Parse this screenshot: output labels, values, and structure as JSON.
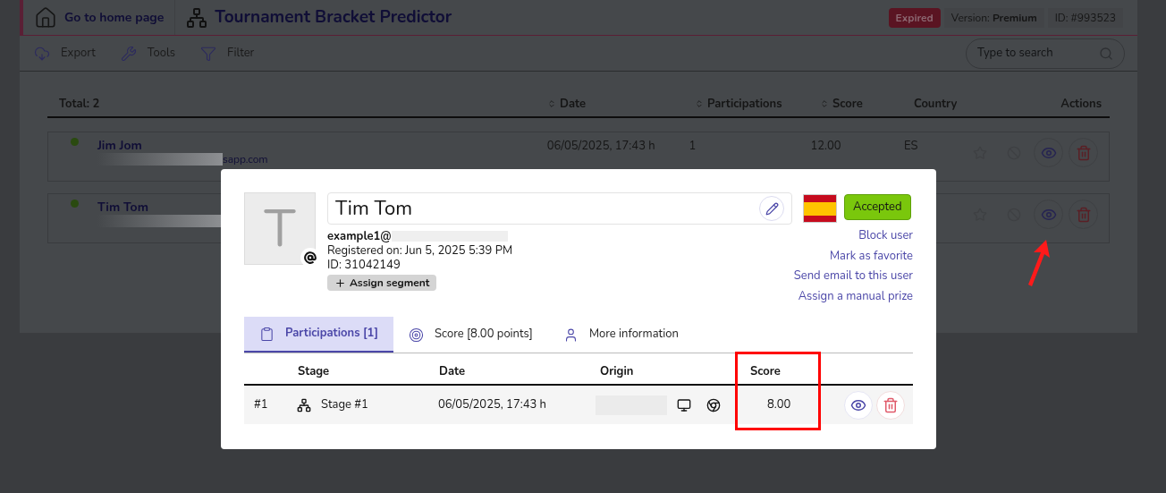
{
  "header": {
    "home_link": "Go to home page",
    "title": "Tournament Bracket Predictor",
    "status_badge": "Expired",
    "version_label": "Version:",
    "version_value": "Premium",
    "account_id": "ID: #993523"
  },
  "toolbar": {
    "actions": [
      "Export",
      "Tools",
      "Filter"
    ],
    "search": {
      "placeholder": "Type to search"
    }
  },
  "table": {
    "total": "Total: 2",
    "columns": [
      {
        "label": "Date",
        "sortable": true
      },
      {
        "label": "Participations",
        "sortable": true
      },
      {
        "label": "Score",
        "sortable": true
      },
      {
        "label": "Country",
        "sortable": false
      },
      {
        "label": "Actions",
        "sortable": false
      }
    ],
    "rows": [
      {
        "name": "Jim Jom",
        "email_tail": "sapp.com",
        "date": "06/05/2025, 17:43 h",
        "participations": "1",
        "score": "12.00",
        "country": "ES"
      },
      {
        "name": "Tim Tom",
        "date": "",
        "participations": "",
        "score": "",
        "country": ""
      }
    ]
  },
  "modal": {
    "avatar_letter": "T",
    "name": "Tim Tom",
    "email": "example1@",
    "registered": "Registered on: Jun 5, 2025 5:39 PM",
    "user_id": "ID: 31042149",
    "assign_segment": "Assign segment",
    "status": "Accepted",
    "links": [
      "Block user",
      "Mark as favorite",
      "Send email to this user",
      "Assign a manual prize"
    ],
    "tabs": [
      {
        "label": "Participations [1]",
        "selected": true
      },
      {
        "label": "Score [8.00 points]",
        "selected": false
      },
      {
        "label": "More information",
        "selected": false
      }
    ],
    "columns": [
      "Stage",
      "Date",
      "Origin",
      "Score"
    ],
    "rows": [
      {
        "number": "#1",
        "stage": "Stage #1",
        "date": "06/05/2025, 17:43 h",
        "score": "8.00"
      }
    ]
  }
}
